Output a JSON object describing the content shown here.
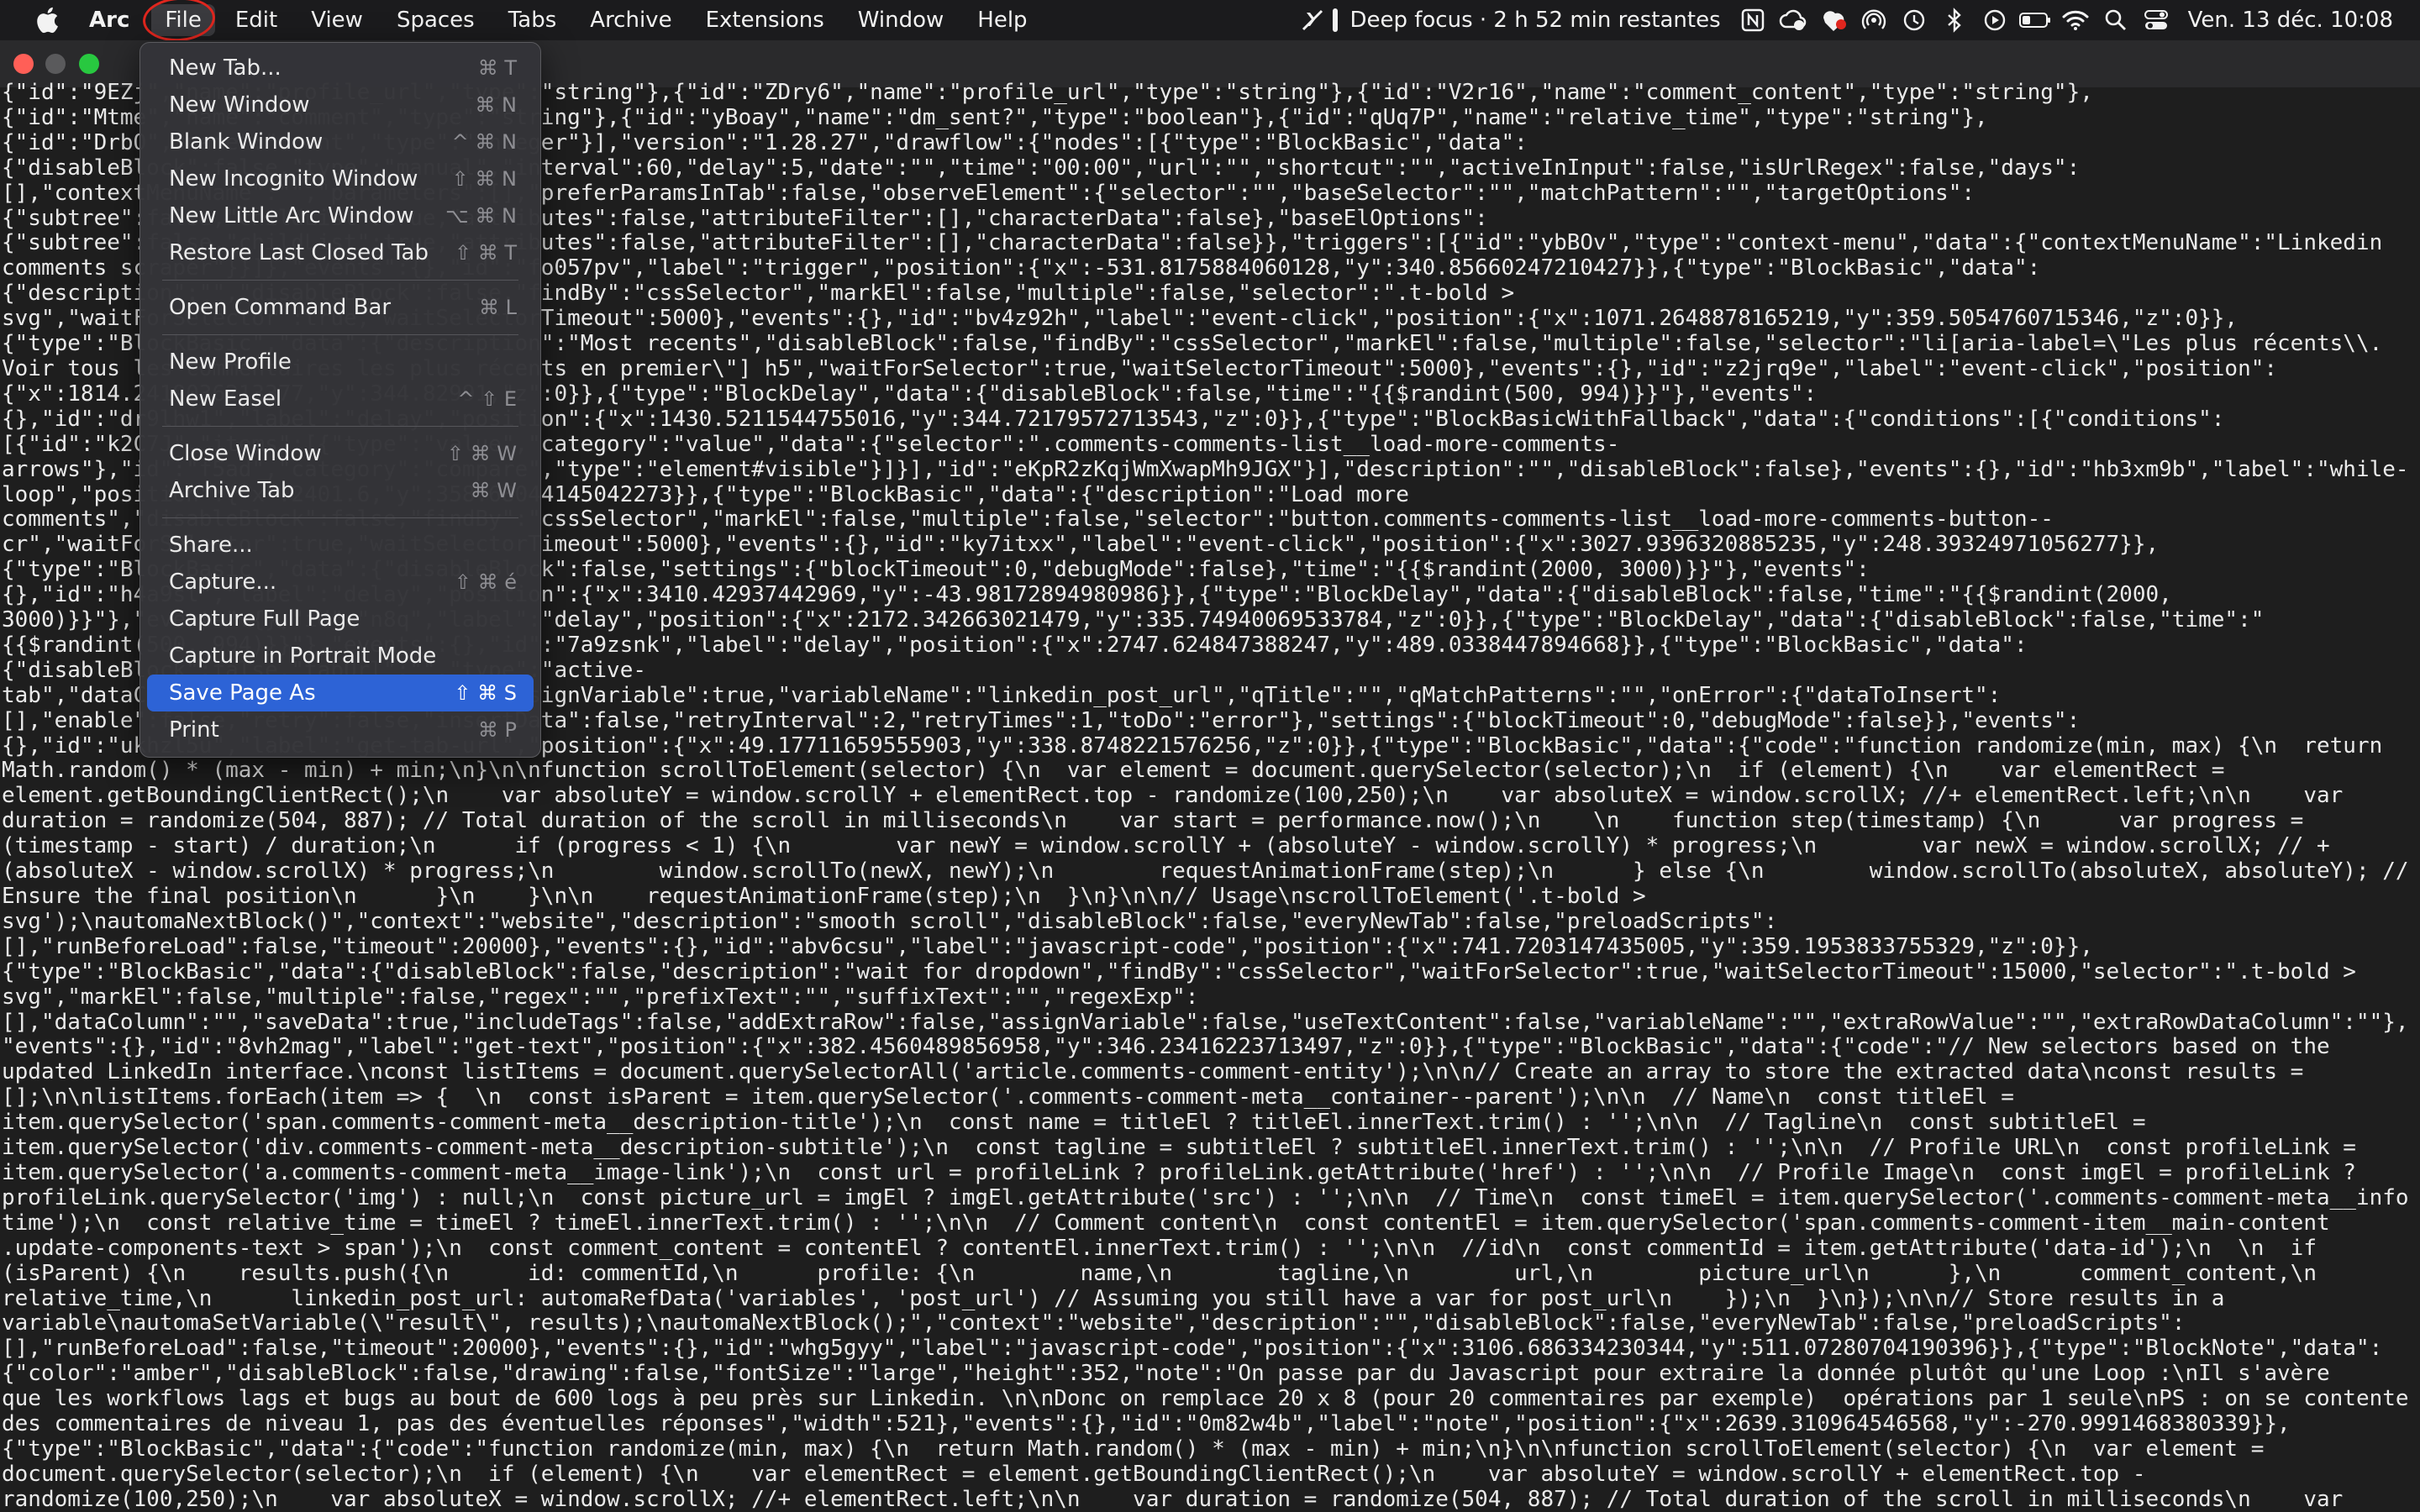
{
  "menubar": {
    "app_name": "Arc",
    "menus": [
      "File",
      "Edit",
      "View",
      "Spaces",
      "Tabs",
      "Archive",
      "Extensions",
      "Window",
      "Help"
    ],
    "focus_text": "Deep focus · 2 h 52 min restantes",
    "clock": "Ven. 13 déc.  10:08"
  },
  "file_menu": {
    "groups": [
      [
        {
          "label": "New Tab...",
          "shortcut": "⌘ T"
        },
        {
          "label": "New Window",
          "shortcut": "⌘ N"
        },
        {
          "label": "Blank Window",
          "shortcut": "^ ⌘ N"
        },
        {
          "label": "New Incognito Window",
          "shortcut": "⇧ ⌘ N"
        },
        {
          "label": "New Little Arc Window",
          "shortcut": "⌥ ⌘ N"
        },
        {
          "label": "Restore Last Closed Tab",
          "shortcut": "⇧ ⌘ T"
        }
      ],
      [
        {
          "label": "Open Command Bar",
          "shortcut": "⌘ L"
        }
      ],
      [
        {
          "label": "New Profile",
          "shortcut": ""
        },
        {
          "label": "New Easel",
          "shortcut": "^ ⇧ E"
        }
      ],
      [
        {
          "label": "Close Window",
          "shortcut": "⇧ ⌘ W"
        },
        {
          "label": "Archive Tab",
          "shortcut": "⌘ W"
        }
      ],
      [
        {
          "label": "Share...",
          "shortcut": ""
        },
        {
          "label": "Capture...",
          "shortcut": "⇧ ⌘ é"
        },
        {
          "label": "Capture Full Page",
          "shortcut": ""
        },
        {
          "label": "Capture in Portrait Mode",
          "shortcut": ""
        },
        {
          "label": "Save Page As",
          "shortcut": "⇧ ⌘ S",
          "selected": true
        },
        {
          "label": "Print",
          "shortcut": "⌘ P"
        }
      ]
    ]
  },
  "page": {
    "lines": [
      "{\"id\":\"9EZj\",\"name\":\"profile_url\",\"type\":\"string\"},{\"id\":\"ZDry6\",\"name\":\"profile_url\",\"type\":\"string\"},{\"id\":\"V2r16\",\"name\":\"comment_content\",\"type\":\"string\"},",
      "{\"id\":\"Mtme\",\"name\":\"comment\",\"type\":\"string\"},{\"id\":\"yBoay\",\"name\":\"dm_sent?\",\"type\":\"boolean\"},{\"id\":\"qUq7P\",\"name\":\"relative_time\",\"type\":\"string\"},",
      "{\"id\":\"DrbO\",\"name\":\"count\",\"type\":\"integer\"}],\"version\":\"1.28.27\",\"drawflow\":{\"nodes\":[{\"type\":\"BlockBasic\",\"data\":",
      "{\"disableBlock\":false,\"type\":\"manual\",\"interval\":60,\"delay\":5,\"date\":\"\",\"time\":\"00:00\",\"url\":\"\",\"shortcut\":\"\",\"activeInInput\":false,\"isUrlRegex\":false,\"days\":",
      "[],\"contextMenuName\":\"\",\"parameters\":[],\"preferParamsInTab\":false,\"observeElement\":{\"selector\":\"\",\"baseSelector\":\"\",\"matchPattern\":\"\",\"targetOptions\":",
      "{\"subtree\":false,\"childList\":true,\"attributes\":false,\"attributeFilter\":[],\"characterData\":false},\"baseElOptions\":",
      "{\"subtree\":false,\"childList\":true,\"attributes\":false,\"attributeFilter\":[],\"characterData\":false}},\"triggers\":[{\"id\":\"ybBOv\",\"type\":\"context-menu\",\"data\":{\"contextMenuName\":\"Linkedin",
      "comments scraper\"}}]},\"events\":{},\"id\":\"fo057pv\",\"label\":\"trigger\",\"position\":{\"x\":-531.8175884060128,\"y\":340.85660247210427}},{\"type\":\"BlockBasic\",\"data\":",
      "{\"description\":\"\",\"disableBlock\":false,\"findBy\":\"cssSelector\",\"markEl\":false,\"multiple\":false,\"selector\":\".t-bold >",
      "svg\",\"waitForSelector\":true,\"waitSelectorTimeout\":5000},\"events\":{},\"id\":\"bv4z92h\",\"label\":\"event-click\",\"position\":{\"x\":1071.2648878165219,\"y\":359.5054760715346,\"z\":0}},",
      "{\"type\":\"BlockBasic\",\"data\":{\"description\":\"Most recents\",\"disableBlock\":false,\"findBy\":\"cssSelector\",\"markEl\":false,\"multiple\":false,\"selector\":\"li[aria-label=\\\"Les plus récents\\\\.",
      "Voir tous les commentaires les plus récents en premier\\\"] h5\",\"waitForSelector\":true,\"waitSelectorTimeout\":5000},\"events\":{},\"id\":\"z2jrq9e\",\"label\":\"event-click\",\"position\":",
      "{\"x\":1814.2419036213377,\"y\":344.82991,\"z\":0}},{\"type\":\"BlockDelay\",\"data\":{\"disableBlock\":false,\"time\":\"{{$randint(500, 994)}}\"},\"events\":",
      "{},\"id\":\"dr9lhw1\",\"label\":\"delay\",\"position\":{\"x\":1430.5211544755016,\"y\":344.72179572713543,\"z\":0}},{\"type\":\"BlockBasicWithFallback\",\"data\":{\"conditions\":[{\"conditions\":",
      "[{\"id\":\"k2C7J\",\"items\":[{\"type\":\"value\",\"category\":\"value\",\"data\":{\"selector\":\".comments-comments-list__load-more-comments-",
      "arrows\"},\"id\":\"f5ad\",\"category\":\"compare\",\"type\":\"element#visible\"}]}],\"id\":\"eKpR2zKqjWmXwapMh9JGX\"}],\"description\":\"\",\"disableBlock\":false},\"events\":{},\"id\":\"hb3xm9b\",\"label\":\"while-",
      "loop\",\"position\":{\"x\":2401.6,\"y\":358.68044145042273}},{\"type\":\"BlockBasic\",\"data\":{\"description\":\"Load more",
      "comments\",\"disableBlock\":false,\"findBy\":\"cssSelector\",\"markEl\":false,\"multiple\":false,\"selector\":\"button.comments-comments-list__load-more-comments-button--",
      "cr\",\"waitForSelector\":true,\"waitSelectorTimeout\":5000},\"events\":{},\"id\":\"ky7itxx\",\"label\":\"event-click\",\"position\":{\"x\":3027.9396320885235,\"y\":248.39324971056277}},",
      "{\"type\":\"BlockBasic\",\"data\":{\"disableBlock\":false,\"settings\":{\"blockTimeout\":0,\"debugMode\":false},\"time\":\"{{$randint(2000, 3000)}}\"},\"events\":",
      "{},\"id\":\"h4a9sl\",\"label\":\"delay\",\"position\":{\"x\":3410.42937442969,\"y\":-43.98172894980986}},{\"type\":\"BlockDelay\",\"data\":{\"disableBlock\":false,\"time\":\"{{$randint(2000,",
      "3000)}}\"},\"events\":{},\"id\":\"n8q\",\"label\":\"delay\",\"position\":{\"x\":2172.342663021479,\"y\":335.74940069533784,\"z\":0}},{\"type\":\"BlockDelay\",\"data\":{\"disableBlock\":false,\"time\":\"",
      "{{$randint(500, 994)}}\"},\"events\":{},\"id\":\"7a9zsnk\",\"label\":\"delay\",\"position\":{\"x\":2747.624847388247,\"y\":489.0338447894668}},{\"type\":\"BlockBasic\",\"data\":",
      "{\"disableBlock\":false,\"tabUrl\":\"\",\"type\":\"active-",
      "tab\",\"dataColumn\":\"\",\"saveData\":true,\"assignVariable\":true,\"variableName\":\"linkedin_post_url\",\"qTitle\":\"\",\"qMatchPatterns\":\"\",\"onError\":{\"dataToInsert\":",
      "[],\"enable\":false,\"retry\":false,\"insertData\":false,\"retryInterval\":2,\"retryTimes\":1,\"toDo\":\"error\"},\"settings\":{\"blockTimeout\":0,\"debugMode\":false}},\"events\":",
      "{},\"id\":\"ukhzl5u\",\"label\":\"get-tab-url\",\"position\":{\"x\":49.17711659555903,\"y\":338.8748221576256,\"z\":0}},{\"type\":\"BlockBasic\",\"data\":{\"code\":\"function randomize(min, max) {\\n  return",
      "Math.random() * (max - min) + min;\\n}\\n\\nfunction scrollToElement(selector) {\\n  var element = document.querySelector(selector);\\n  if (element) {\\n    var elementRect =",
      "element.getBoundingClientRect();\\n    var absoluteY = window.scrollY + elementRect.top - randomize(100,250);\\n    var absoluteX = window.scrollX; //+ elementRect.left;\\n\\n    var",
      "duration = randomize(504, 887); // Total duration of the scroll in milliseconds\\n    var start = performance.now();\\n    \\n    function step(timestamp) {\\n      var progress =",
      "(timestamp - start) / duration;\\n      if (progress < 1) {\\n        var newY = window.scrollY + (absoluteY - window.scrollY) * progress;\\n        var newX = window.scrollX; // +",
      "(absoluteX - window.scrollX) * progress;\\n        window.scrollTo(newX, newY);\\n        requestAnimationFrame(step);\\n      } else {\\n        window.scrollTo(absoluteX, absoluteY); //",
      "Ensure the final position\\n      }\\n    }\\n\\n    requestAnimationFrame(step);\\n  }\\n}\\n\\n// Usage\\nscrollToElement('.t-bold >",
      "svg');\\nautomaNextBlock()\",\"context\":\"website\",\"description\":\"smooth scroll\",\"disableBlock\":false,\"everyNewTab\":false,\"preloadScripts\":",
      "[],\"runBeforeLoad\":false,\"timeout\":20000},\"events\":{},\"id\":\"abv6csu\",\"label\":\"javascript-code\",\"position\":{\"x\":741.7203147435005,\"y\":359.1953833755329,\"z\":0}},",
      "{\"type\":\"BlockBasic\",\"data\":{\"disableBlock\":false,\"description\":\"wait for dropdown\",\"findBy\":\"cssSelector\",\"waitForSelector\":true,\"waitSelectorTimeout\":15000,\"selector\":\".t-bold >",
      "svg\",\"markEl\":false,\"multiple\":false,\"regex\":\"\",\"prefixText\":\"\",\"suffixText\":\"\",\"regexExp\":",
      "[],\"dataColumn\":\"\",\"saveData\":true,\"includeTags\":false,\"addExtraRow\":false,\"assignVariable\":false,\"useTextContent\":false,\"variableName\":\"\",\"extraRowValue\":\"\",\"extraRowDataColumn\":\"\"},",
      "\"events\":{},\"id\":\"8vh2mag\",\"label\":\"get-text\",\"position\":{\"x\":382.4560489856958,\"y\":346.23416223713497,\"z\":0}},{\"type\":\"BlockBasic\",\"data\":{\"code\":\"// New selectors based on the",
      "updated LinkedIn interface.\\nconst listItems = document.querySelectorAll('article.comments-comment-entity');\\n\\n// Create an array to store the extracted data\\nconst results =",
      "[];\\n\\nlistItems.forEach(item => {  \\n  const isParent = item.querySelector('.comments-comment-meta__container--parent');\\n\\n  // Name\\n  const titleEl =",
      "item.querySelector('span.comments-comment-meta__description-title');\\n  const name = titleEl ? titleEl.innerText.trim() : '';\\n\\n  // Tagline\\n  const subtitleEl =",
      "item.querySelector('div.comments-comment-meta__description-subtitle');\\n  const tagline = subtitleEl ? subtitleEl.innerText.trim() : '';\\n\\n  // Profile URL\\n  const profileLink =",
      "item.querySelector('a.comments-comment-meta__image-link');\\n  const url = profileLink ? profileLink.getAttribute('href') : '';\\n\\n  // Profile Image\\n  const imgEl = profileLink ?",
      "profileLink.querySelector('img') : null;\\n  const picture_url = imgEl ? imgEl.getAttribute('src') : '';\\n\\n  // Time\\n  const timeEl = item.querySelector('.comments-comment-meta__info",
      "time');\\n  const relative_time = timeEl ? timeEl.innerText.trim() : '';\\n\\n  // Comment content\\n  const contentEl = item.querySelector('span.comments-comment-item__main-content",
      ".update-components-text > span');\\n  const comment_content = contentEl ? contentEl.innerText.trim() : '';\\n\\n  //id\\n  const commentId = item.getAttribute('data-id');\\n  \\n  if",
      "(isParent) {\\n    results.push({\\n      id: commentId,\\n      profile: {\\n        name,\\n        tagline,\\n        url,\\n        picture_url\\n      },\\n      comment_content,\\n",
      "relative_time,\\n      linkedin_post_url: automaRefData('variables', 'post_url') // Assuming you still have a var for post_url\\n    });\\n  }\\n});\\n\\n// Store results in a",
      "variable\\nautomaSetVariable(\\\"result\\\", results);\\nautomaNextBlock();\",\"context\":\"website\",\"description\":\"\",\"disableBlock\":false,\"everyNewTab\":false,\"preloadScripts\":",
      "[],\"runBeforeLoad\":false,\"timeout\":20000},\"events\":{},\"id\":\"whg5gyy\",\"label\":\"javascript-code\",\"position\":{\"x\":3106.686334230344,\"y\":511.07280704190396}},{\"type\":\"BlockNote\",\"data\":",
      "{\"color\":\"amber\",\"disableBlock\":false,\"drawing\":false,\"fontSize\":\"large\",\"height\":352,\"note\":\"On passe par du Javascript pour extraire la donnée plutôt qu'une Loop :\\nIl s'avère",
      "que les workflows lags et bugs au bout de 600 logs à peu près sur Linkedin. \\n\\nDonc on remplace 20 x 8 (pour 20 commentaires par exemple)  opérations par 1 seule\\nPS : on se contente",
      "des commentaires de niveau 1, pas des éventuelles réponses\",\"width\":521},\"events\":{},\"id\":\"0m82w4b\",\"label\":\"note\",\"position\":{\"x\":2639.310964546568,\"y\":-270.9991468380339}},",
      "{\"type\":\"BlockBasic\",\"data\":{\"code\":\"function randomize(min, max) {\\n  return Math.random() * (max - min) + min;\\n}\\n\\nfunction scrollToElement(selector) {\\n  var element =",
      "document.querySelector(selector);\\n  if (element) {\\n    var elementRect = element.getBoundingClientRect();\\n    var absoluteY = window.scrollY + elementRect.top -",
      "randomize(100,250);\\n    var absoluteX = window.scrollX; //+ elementRect.left;\\n\\n    var duration = randomize(504, 887); // Total duration of the scroll in milliseconds\\n    var"
    ]
  }
}
